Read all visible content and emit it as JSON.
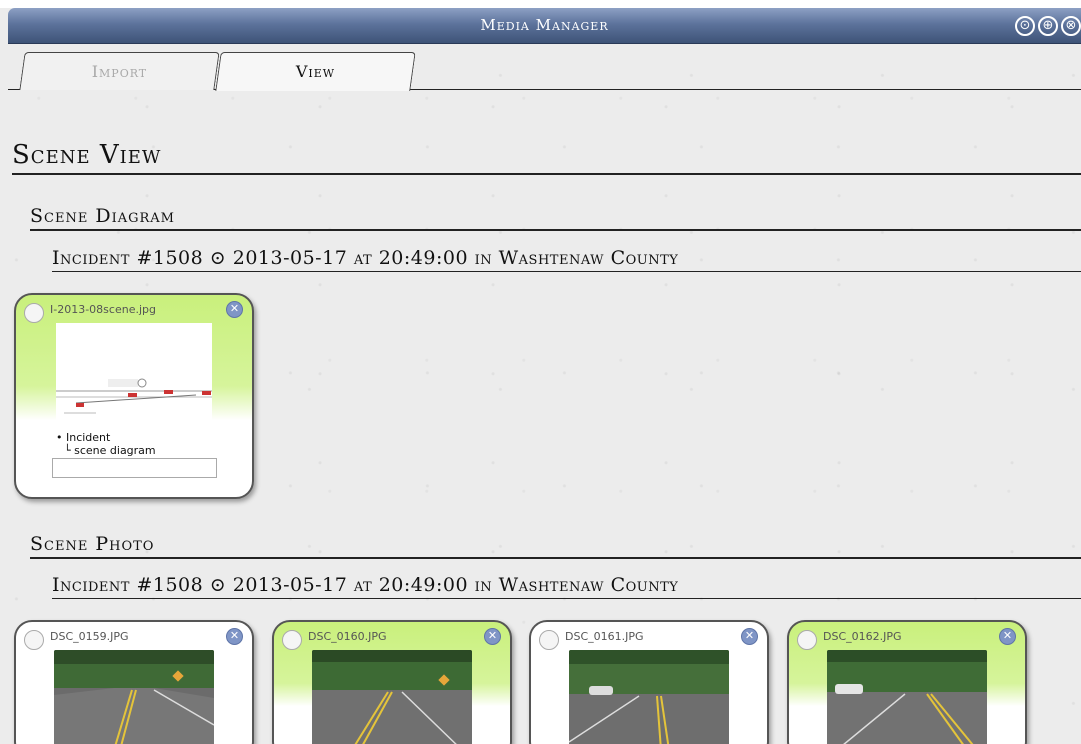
{
  "window": {
    "title": "Media Manager",
    "controls": [
      {
        "name": "target-icon",
        "glyph": "⊙"
      },
      {
        "name": "add-icon",
        "glyph": "⊕"
      },
      {
        "name": "close-icon",
        "glyph": "⊗"
      }
    ]
  },
  "tabs": [
    {
      "label": "Import",
      "active": false
    },
    {
      "label": "View",
      "active": true
    }
  ],
  "page_title": "Scene View",
  "sections": [
    {
      "heading": "Scene Diagram",
      "incident": "Incident #1508 ⊙ 2013-05-17 at 20:49:00 in Washtenaw County",
      "items": [
        {
          "filename": "I-2013-08scene.jpg",
          "tree_parent": "• Incident",
          "tree_child": "└ scene diagram",
          "caption": ""
        }
      ]
    },
    {
      "heading": "Scene Photo",
      "incident": "Incident #1508 ⊙ 2013-05-17 at 20:49:00 in Washtenaw County",
      "items": [
        {
          "filename": "DSC_0159.JPG",
          "selected": false
        },
        {
          "filename": "DSC_0160.JPG",
          "selected": true
        },
        {
          "filename": "DSC_0161.JPG",
          "selected": false
        },
        {
          "filename": "DSC_0162.JPG",
          "selected": true
        }
      ]
    }
  ],
  "colors": {
    "titlebar": "#5d739c",
    "card_selected": "#c9f07c",
    "close_badge": "#7f95c6"
  }
}
